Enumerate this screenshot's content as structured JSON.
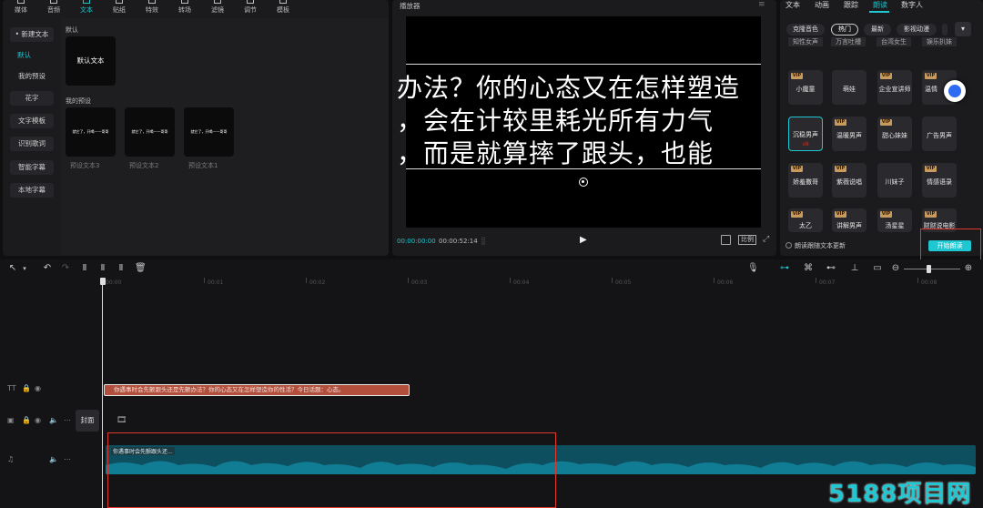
{
  "top_tabs": [
    {
      "label": "媒体",
      "icon": "media-icon"
    },
    {
      "label": "音频",
      "icon": "audio-icon"
    },
    {
      "label": "文本",
      "icon": "text-icon",
      "active": true
    },
    {
      "label": "贴纸",
      "icon": "sticker-icon"
    },
    {
      "label": "特效",
      "icon": "effects-icon"
    },
    {
      "label": "转场",
      "icon": "transition-icon"
    },
    {
      "label": "滤镜",
      "icon": "filter-icon"
    },
    {
      "label": "调节",
      "icon": "adjust-icon"
    },
    {
      "label": "模板",
      "icon": "template-icon"
    }
  ],
  "sidebar": {
    "items": [
      {
        "label": "• 新建文本"
      },
      {
        "label": "默认"
      },
      {
        "label": "我的预设"
      },
      {
        "label": "花字"
      },
      {
        "label": "文字模板"
      },
      {
        "label": "识别歌词"
      },
      {
        "label": "智能字幕"
      },
      {
        "label": "本地字幕"
      }
    ]
  },
  "content": {
    "section_default": "默认",
    "default_card": "默认文本",
    "section_presets": "我的预设",
    "preset_card_text": "就它了，开喝——哥哥",
    "presets": [
      "预设文本3",
      "预设文本2",
      "预设文本1"
    ]
  },
  "player": {
    "title": "播放器",
    "lines": [
      "办法？你的心态又在怎样塑造",
      "，会在计较里耗光所有力气",
      "，而是就算摔了跟头，也能"
    ],
    "time_current": "00:00:00:00",
    "time_total": "00:00:52:14",
    "ratio_label": "比例"
  },
  "right": {
    "tabs": [
      "文本",
      "动画",
      "跟踪",
      "朗读",
      "数字人"
    ],
    "active_tab": "朗读",
    "chips": [
      "克隆音色",
      "热门",
      "最新",
      "影视动漫"
    ],
    "partial_row": [
      "知性女声",
      "万言吐槽",
      "台湾女生",
      "娱乐扒妹"
    ],
    "voices": [
      {
        "name": "小魔童",
        "vip": true
      },
      {
        "name": "萌娃",
        "vip": false
      },
      {
        "name": "企业宣讲师",
        "vip": true
      },
      {
        "name": "温情",
        "vip": true
      },
      {
        "name": "沉稳男声",
        "vip": false,
        "selected": true
      },
      {
        "name": "温暖男声",
        "vip": true
      },
      {
        "name": "甜心妹妹",
        "vip": true
      },
      {
        "name": "广告男声",
        "vip": false
      },
      {
        "name": "娇羞撒哥",
        "vip": true
      },
      {
        "name": "紫薇说唱",
        "vip": true
      },
      {
        "name": "川妹子",
        "vip": false
      },
      {
        "name": "情感语录",
        "vip": true
      },
      {
        "name": "太乙",
        "vip": true
      },
      {
        "name": "讲解男声",
        "vip": true
      },
      {
        "name": "汤星星",
        "vip": true
      },
      {
        "name": "财财说电影",
        "vip": true
      }
    ],
    "vip_label": "VIP",
    "update_toggle": "朗读跟随文本更新",
    "start_button": "开始朗读"
  },
  "timeline": {
    "ticks": [
      "00:00",
      "00:01",
      "00:02",
      "00:03",
      "00:04",
      "00:05",
      "00:06",
      "00:07",
      "00:08"
    ],
    "text_clip": "你遇事时会先颤跟头还是先颤办法？你的心态又在怎样塑造你的性活？今日话题：心态。",
    "cover_label": "封面",
    "audio_clip": "你遇事时会先颤跟头还...",
    "colors": {
      "text_clip": "#b24f3c",
      "audio_wave": "#117d95",
      "accent": "#1ec7d1",
      "highlight": "#e0362b"
    }
  },
  "watermark": "5188项目网"
}
